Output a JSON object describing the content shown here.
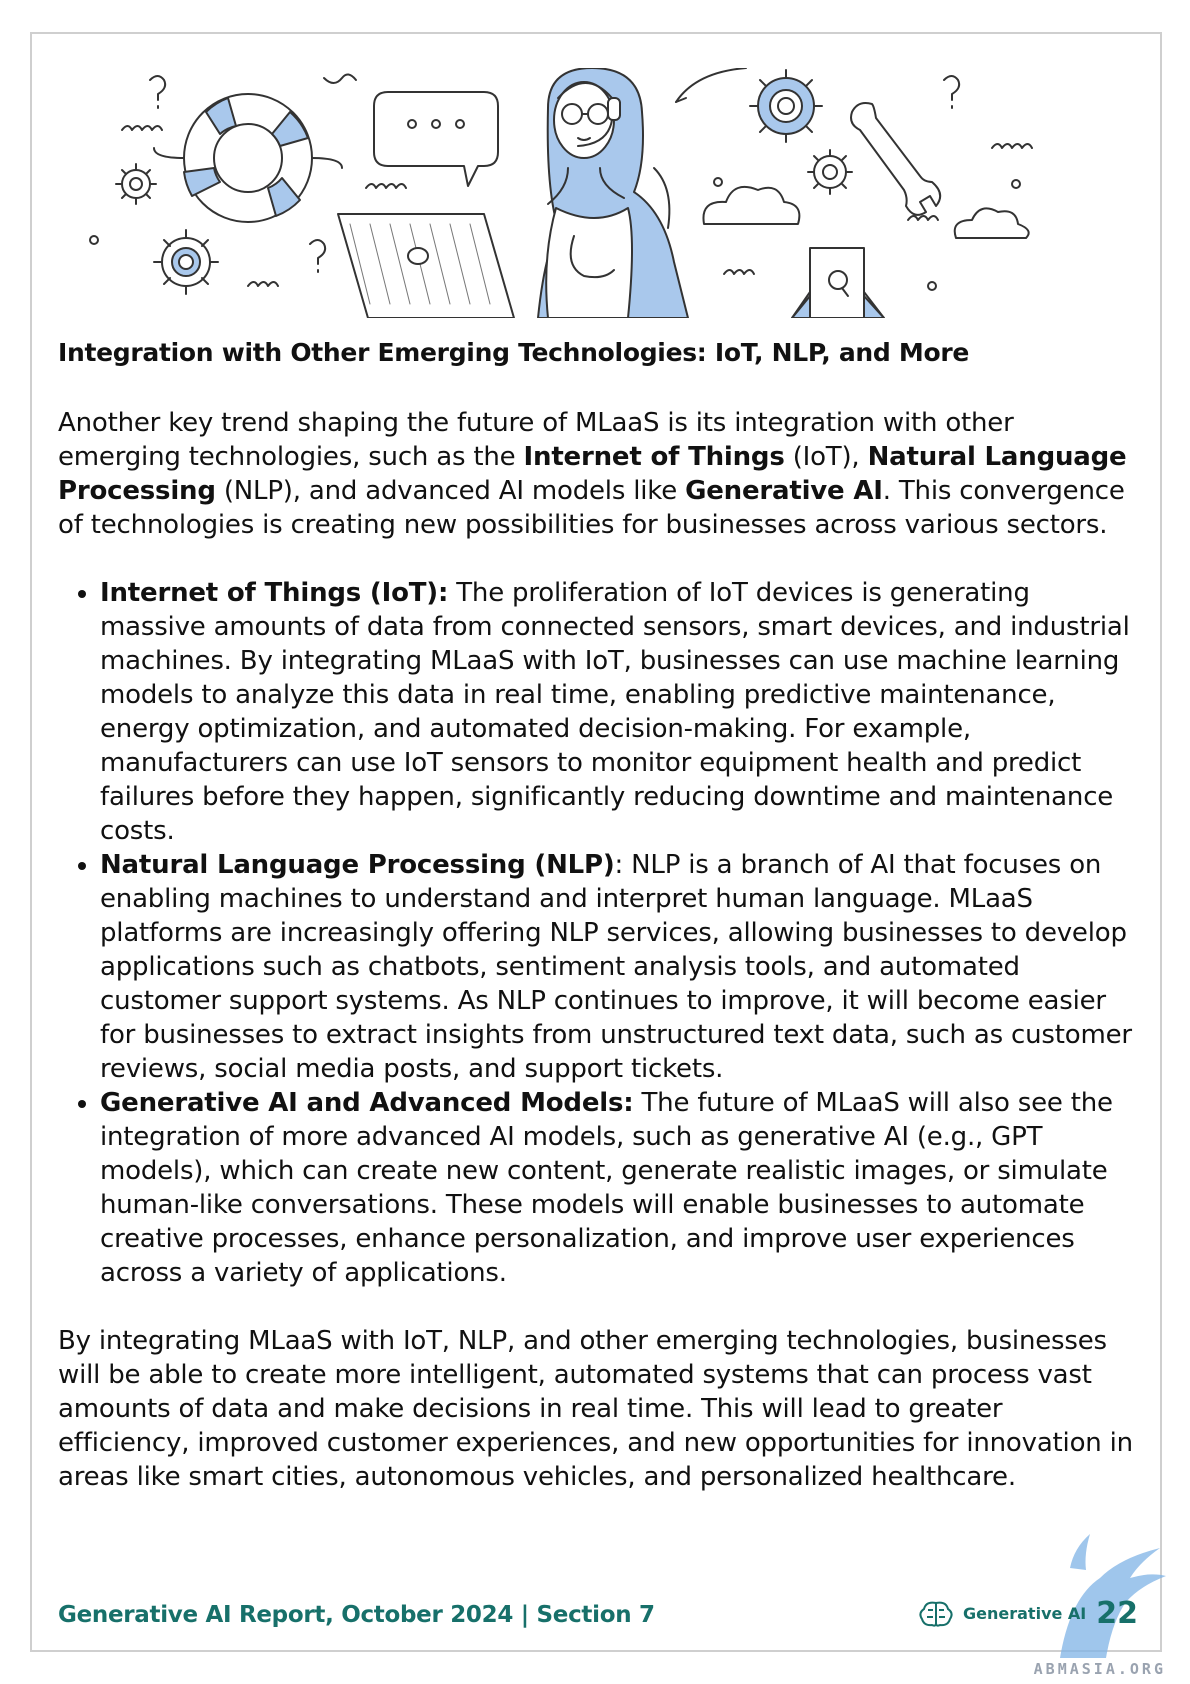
{
  "heading": "Integration with Other Emerging Technologies: IoT, NLP, and More",
  "intro": {
    "t1": "Another key trend shaping the future of MLaaS is its integration with other emerging technologies, such as the ",
    "b1": "Internet of Things",
    "t2": " (IoT), ",
    "b2": "Natural Language Processing",
    "t3": " (NLP), and advanced AI models like ",
    "b3": "Generative AI",
    "t4": ". This convergence of technologies is creating new possibilities for businesses across various sectors."
  },
  "bullets": [
    {
      "label": "Internet of Things (IoT):",
      "text": " The proliferation of IoT devices is generating massive amounts of data from connected sensors, smart devices, and industrial machines. By integrating MLaaS with IoT, businesses can use machine learning models to analyze this data in real time, enabling predictive maintenance, energy optimization, and automated decision-making. For example, manufacturers can use IoT sensors to monitor equipment health and predict failures before they happen, significantly reducing downtime and maintenance costs."
    },
    {
      "label": "Natural Language Processing (NLP)",
      "text": ": NLP is a branch of AI that focuses on enabling machines to understand and interpret human language. MLaaS platforms are increasingly offering NLP services, allowing businesses to develop applications such as chatbots, sentiment analysis tools, and automated customer support systems. As NLP continues to improve, it will become easier for businesses to extract insights from unstructured text data, such as customer reviews, social media posts, and support tickets."
    },
    {
      "label": "Generative AI and Advanced Models:",
      "text": " The future of MLaaS will also see the integration of more advanced AI models, such as generative AI (e.g., GPT models), which can create new content, generate realistic images, or simulate human-like conversations. These models will enable businesses to automate creative processes, enhance personalization, and improve user experiences across a variety of applications."
    }
  ],
  "closing": "By integrating MLaaS with IoT, NLP, and other emerging technologies, businesses will be able to create more intelligent, automated systems that can process vast amounts of data and make decisions in real time. This will lead to greater efficiency, improved customer experiences, and new opportunities for innovation in areas like smart cities, autonomous vehicles, and personalized healthcare.",
  "footer": {
    "report": "Generative AI Report, October 2024 | Section 7",
    "brand": "Generative AI",
    "page": "22"
  },
  "watermark": "ABMASIA.ORG",
  "colors": {
    "accent": "#17706a",
    "illustration": "#a9c8ec",
    "line": "#333333"
  },
  "icons": [
    "brain-icon",
    "lifebuoy-icon",
    "gear-icon",
    "speech-bubble-icon",
    "laptop-icon",
    "wrench-icon",
    "cloud-icon",
    "question-mark-icon"
  ]
}
